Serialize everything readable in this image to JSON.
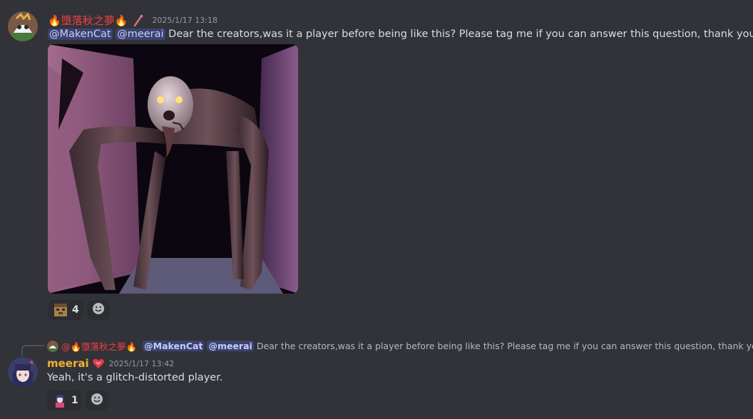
{
  "messages": [
    {
      "author": {
        "name_prefix_emoji": "🔥",
        "name": "墮落秋之夢",
        "name_suffix_emoji": "🔥",
        "name_color": "#f23f43",
        "badge_icon": "brush-icon"
      },
      "timestamp": "2025/1/17 13:18",
      "mentions": [
        "@MakenCat",
        "@meerai"
      ],
      "text": "Dear the creators,was it a player before being like this? Please tag me if you can answer this question, thank you",
      "attachment": {
        "type": "image",
        "description_icon": "creepy-creature-image"
      },
      "reactions": [
        {
          "emoji": "cube-face-emoji",
          "count": "4"
        }
      ]
    },
    {
      "reply_to": {
        "author_display": "@🔥墮落秋之夢🔥",
        "mentions": [
          "@MakenCat",
          "@meerai"
        ],
        "text": "Dear the creators,was it a player before being like this? Please tag me if you can answer this question, thank you"
      },
      "author": {
        "name": "meerai",
        "name_color": "#f0b232",
        "badge_icon": "heart-icon"
      },
      "timestamp": "2025/1/17 13:42",
      "text": "Yeah, it's a glitch-distorted player.",
      "reactions": [
        {
          "emoji": "anime-character-emoji",
          "count": "1"
        }
      ]
    }
  ]
}
